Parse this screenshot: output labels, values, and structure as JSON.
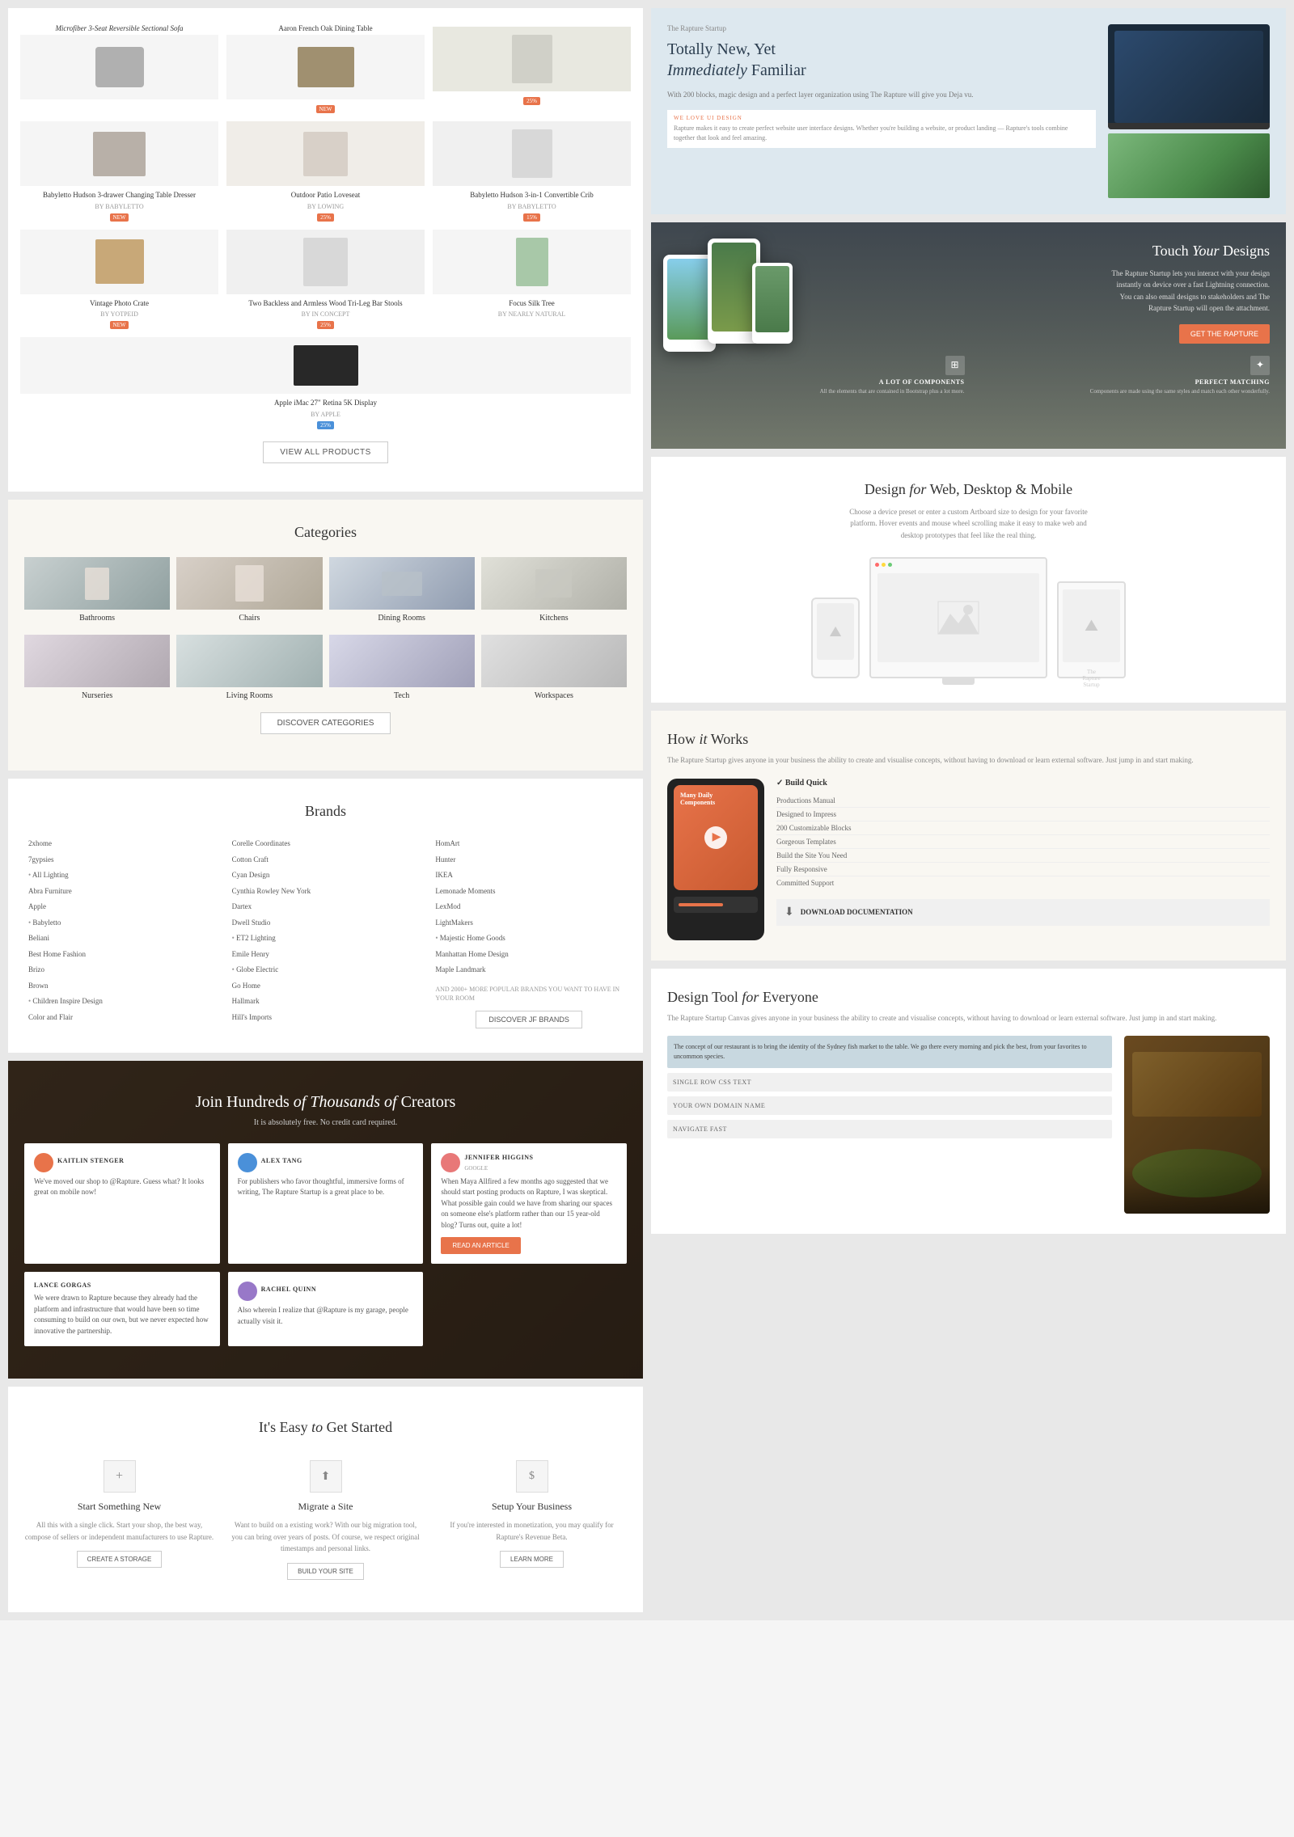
{
  "left": {
    "products": {
      "items": [
        {
          "name": "Babyletto Hudson 3-drawer Changing Table Dresser",
          "brand": "BY BABYLETTO",
          "badge": "NEW",
          "badge_color": "orange",
          "img": "dresser"
        },
        {
          "name": "Outdoor Patio Loveseat",
          "brand": "BY LOWING",
          "badge": "25%",
          "badge_color": "orange",
          "img": "sofa"
        },
        {
          "name": "Babyletto Hudson 3-in-1 Convertible Crib",
          "brand": "BY BABYLETTO",
          "badge": "15%",
          "badge_color": "orange",
          "img": "crib"
        },
        {
          "name": "Vintage Photo Crate",
          "brand": "BY YOTPEID",
          "badge": "NEW",
          "badge_color": "orange",
          "img": "crate"
        },
        {
          "name": "Two Backless and Armless Wood Tri-Leg Bar Stools",
          "brand": "BY IN CONCEPT",
          "badge": "25%",
          "badge_color": "orange",
          "img": "stool"
        },
        {
          "name": "Focus Silk Tree",
          "brand": "BY NEARLY NATURAL",
          "badge": "",
          "badge_color": "",
          "img": "plant"
        },
        {
          "name": "Apple iMac 27\" Retina 5K Display",
          "brand": "BY APPLE",
          "badge": "25%",
          "badge_color": "blue",
          "img": "tv"
        }
      ],
      "view_all_label": "VIEW ALL PRODUCTS"
    },
    "categories": {
      "title": "Categories",
      "items": [
        {
          "label": "Bathrooms",
          "img_class": "cat-bath"
        },
        {
          "label": "Chairs",
          "img_class": "cat-chairs"
        },
        {
          "label": "Dining Rooms",
          "img_class": "cat-dining"
        },
        {
          "label": "Kitchens",
          "img_class": "cat-kitchens"
        },
        {
          "label": "Nurseries",
          "img_class": "cat-nurseries"
        },
        {
          "label": "Living Rooms",
          "img_class": "cat-living"
        },
        {
          "label": "Tech",
          "img_class": "cat-tech"
        },
        {
          "label": "Workspaces",
          "img_class": "cat-workspaces"
        }
      ],
      "discover_label": "DISCOVER CATEGORIES"
    },
    "brands": {
      "title": "Brands",
      "col1": [
        {
          "name": "2xhome",
          "dot": false
        },
        {
          "name": "7gypsies",
          "dot": false
        },
        {
          "name": "All Lighting",
          "dot": true
        },
        {
          "name": "Abra Furniture",
          "dot": false
        },
        {
          "name": "Apple",
          "dot": false
        },
        {
          "name": "Babyletto",
          "dot": true
        },
        {
          "name": "Beliani",
          "dot": false
        },
        {
          "name": "Best Home Fashion",
          "dot": false
        },
        {
          "name": "Brizo",
          "dot": false
        },
        {
          "name": "Brown",
          "dot": false
        },
        {
          "name": "Children Inspire Design",
          "dot": true
        },
        {
          "name": "Color and Flair",
          "dot": false
        }
      ],
      "col2": [
        {
          "name": "Corelle Coordinates",
          "dot": false
        },
        {
          "name": "Cotton Craft",
          "dot": false
        },
        {
          "name": "Cyan Design",
          "dot": false
        },
        {
          "name": "Cynthia Rowley New York",
          "dot": false
        },
        {
          "name": "Dartex",
          "dot": false
        },
        {
          "name": "Dwell Studio",
          "dot": false
        },
        {
          "name": "ET2 Lighting",
          "dot": true
        },
        {
          "name": "Emile Henry",
          "dot": false
        },
        {
          "name": "Globe Electric",
          "dot": true
        },
        {
          "name": "Go Home",
          "dot": false
        },
        {
          "name": "Hallmark",
          "dot": false
        },
        {
          "name": "Hill's Imports",
          "dot": false
        }
      ],
      "col3": [
        {
          "name": "HomArt",
          "dot": false
        },
        {
          "name": "Hunter",
          "dot": false
        },
        {
          "name": "IKEA",
          "dot": false
        },
        {
          "name": "Lemonade Moments",
          "dot": false
        },
        {
          "name": "LexMod",
          "dot": false
        },
        {
          "name": "LightMakers",
          "dot": false
        },
        {
          "name": "Majestic Home Goods",
          "dot": true
        },
        {
          "name": "Manhattan Home Design",
          "dot": false
        },
        {
          "name": "Maple Landmark",
          "dot": false
        }
      ],
      "more_text": "AND 2000+ MORE POPULAR BRANDS YOU WANT TO HAVE IN YOUR ROOM",
      "discover_label": "DISCOVER JF BRANDS"
    },
    "join": {
      "title": "Join Hundreds of Thousands of Creators",
      "title_italic": "of Thousands of",
      "subtitle": "It is absolutely free. No credit card required.",
      "testimonials": [
        {
          "user": "KAITLIN STENGER",
          "sub": "",
          "avatar_color": "#e8734a",
          "text": "We've moved our shop to @Rapture. Guess what? It looks great on mobile now!"
        },
        {
          "user": "ALEX TANG",
          "sub": "",
          "avatar_color": "#4a90d9",
          "text": "For publishers who favor thoughtful, immersive forms of writing, The Rapture Startup is a great place to be.",
          "has_read": true
        },
        {
          "user": "JENNIFER HIGGINS",
          "sub": "GOOGLE",
          "avatar_color": "#e87878",
          "text": "When Maya Allfired a few months ago suggested that we should start posting products on Rapture, I was skeptical. What possible gain could we have from sharing our spaces on someone else's platform rather than our 15 year-old blog? Turns out, quite a lot!",
          "has_read": true
        },
        {
          "user": "LANCE GORGAS",
          "sub": "",
          "avatar_color": "#78c878",
          "text": "We were drawn to Rapture because they already had the platform and infrastructure that would have been so time consuming to build on our own, but we never expected how innovative the partnership."
        },
        {
          "user": "RACHEL QUINN",
          "sub": "",
          "avatar_color": "#9878c8",
          "text": "Also wherein I realize that @Rapture is my garage, people actually visit it."
        }
      ],
      "read_article_label": "READ AN ARTICLE"
    },
    "get_started": {
      "title": "It's Easy to Get Started",
      "items": [
        {
          "title": "Start Something New",
          "text": "All this with a single click. Start your shop, the best way, compose of sellers or independent manufacturers to use Rapture.",
          "btn": "CREATE A STORAGE"
        },
        {
          "title": "Migrate a Site",
          "text": "Want to build on a existing work? With our big migration tool, you can bring over years of posts. Of course, we respect original timestamps and personal links.",
          "btn": "BUILD YOUR SITE"
        },
        {
          "title": "Setup Your Business",
          "text": "If you're interested in monetization, you may qualify for Rapture's Revenue Beta.",
          "btn": "LEARN MORE"
        }
      ]
    }
  },
  "right": {
    "rapture": {
      "tag": "The Rapture Startup",
      "title_part1": "Totally New, Yet",
      "title_part2": "Immediately",
      "title_part3": "Familiar",
      "desc": "With 200 blocks, magic design and a perfect layer organization using The Rapture will give you Deja vu.",
      "love_ui": "WE LOVE UI DESIGN",
      "love_desc": "Rapture makes it easy to create perfect website user interface designs. Whether you're building a website, or product landing — Rapture's tools combine together that look and feel amazing."
    },
    "touch": {
      "title_part1": "Touch",
      "title_part2": "Your",
      "title_part3": "Designs",
      "desc": "The Rapture Startup lets you interact with your design instantly on device over a fast Lightning connection. You can also email designs to stakeholders and The Rapture Startup will open the attachment.",
      "btn_label": "GET THE RAPTURE",
      "features": [
        {
          "title": "A LOT OF COMPONENTS",
          "desc": "All the elements that are contained in Bootstrap plus a lot more."
        },
        {
          "title": "PERFECT MATCHING",
          "desc": "Components are made using the same styles and match each other wonderfully."
        }
      ]
    },
    "design_web": {
      "title_part1": "Design",
      "title_part2": "for",
      "title_part3": "Web, Desktop & Mobile",
      "desc": "Choose a device preset or enter a custom Artboard size to design for your favorite platform. Hover events and mouse wheel scrolling make it easy to make web and desktop prototypes that feel like the real thing."
    },
    "how_it_works": {
      "title_part1": "How",
      "title_part2": "it",
      "title_part3": "Works",
      "desc": "The Rapture Startup gives anyone in your business the ability to create and visualise concepts, without having to download or learn external software. Just jump in and start making.",
      "build_title": "✓ Build Quick",
      "build_items": [
        "Productions Manual",
        "Designed to Impress",
        "200 Customizable Blocks",
        "Gorgeous Templates",
        "Build the Site You Need",
        "Fully Responsive",
        "Committed Support"
      ],
      "download_label": "DOWNLOAD DOCUMENTATION"
    },
    "design_tool": {
      "title_part1": "Design Tool",
      "title_part2": "for",
      "title_part3": "Everyone",
      "desc": "The Rapture Startup Canvas gives anyone in your business the ability to create and visualise concepts, without having to download or learn external software. Just jump in and start making.",
      "concepts": [
        {
          "text": "The concept of our restaurant is to bring the identity of the Sydney fish market to the table. We go there every morning and pick the best, from your favorites to uncommon species.",
          "active": true
        },
        {
          "text": "SINGLE ROW CSS TEXT",
          "active": false
        },
        {
          "text": "YOUR OWN DOMAIN NAME",
          "active": false
        },
        {
          "text": "NAVIGATE FAST",
          "active": false
        }
      ]
    }
  }
}
